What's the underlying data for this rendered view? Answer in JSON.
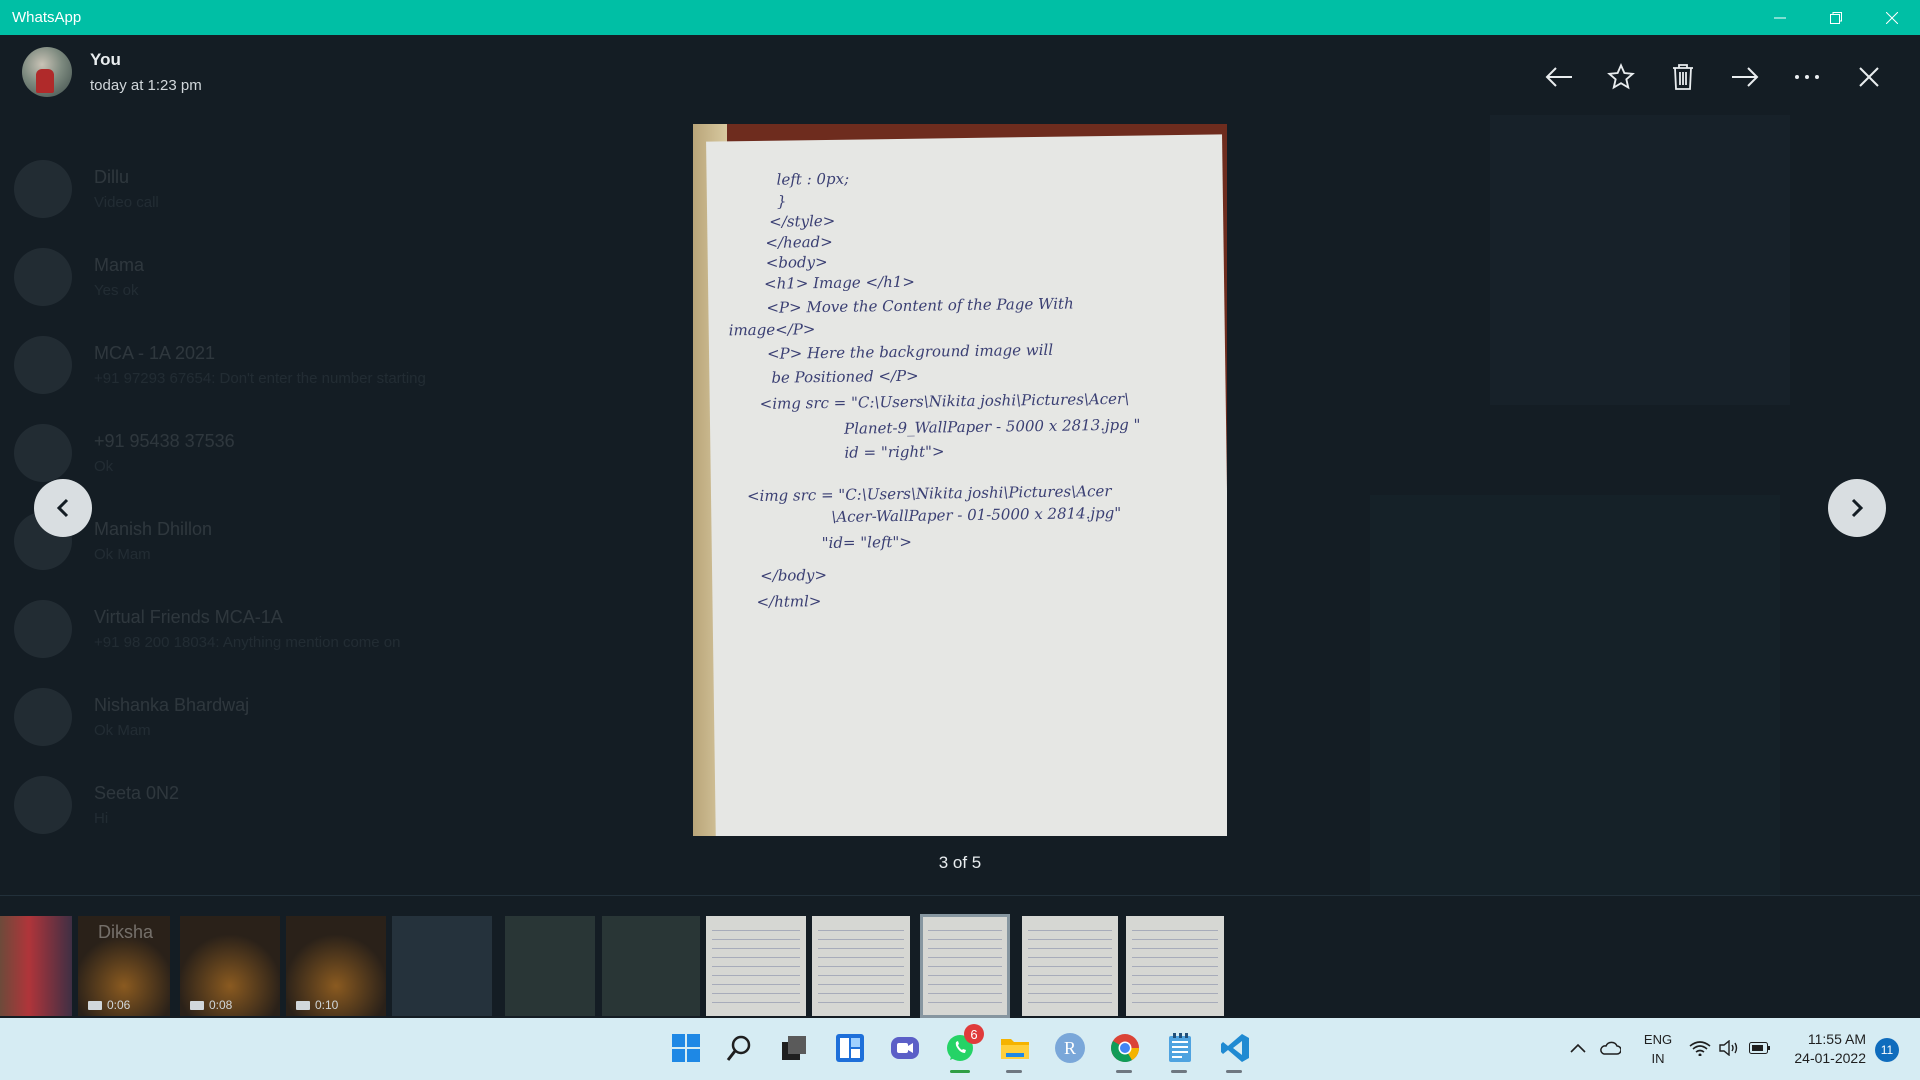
{
  "window": {
    "title": "WhatsApp",
    "controls": [
      "minimize-icon",
      "restore-icon",
      "close-icon"
    ]
  },
  "header": {
    "sender_name": "You",
    "timestamp": "today at 1:23 pm"
  },
  "toolbar": {
    "items": [
      {
        "name": "back-button",
        "icon": "arrow-left-icon"
      },
      {
        "name": "star-button",
        "icon": "star-icon"
      },
      {
        "name": "delete-button",
        "icon": "trash-icon"
      },
      {
        "name": "forward-button",
        "icon": "arrow-right-icon"
      },
      {
        "name": "more-options-button",
        "icon": "ellipsis-icon"
      },
      {
        "name": "close-viewer-button",
        "icon": "close-icon"
      }
    ]
  },
  "background_chats": [
    {
      "name": "Dillu",
      "preview": "Video call"
    },
    {
      "name": "Mama",
      "preview": "Yes ok"
    },
    {
      "name": "MCA - 1A 2021",
      "preview": "+91 97293 67654: Don't enter the number starting"
    },
    {
      "name": "+91 95438 37536",
      "preview": "Ok"
    },
    {
      "name": "Manish Dhillon",
      "preview": "Ok Mam"
    },
    {
      "name": "Virtual Friends MCA-1A",
      "preview": "+91 98 200 18034: Anything mention come on"
    },
    {
      "name": "Nishanka Bhardwaj",
      "preview": "Ok Mam"
    },
    {
      "name": "Seeta 0N2",
      "preview": "Hi"
    }
  ],
  "media": {
    "handwritten_lines": [
      "left : 0px;",
      "}",
      "</style>",
      "</head>",
      "<body>",
      "<h1> Image </h1>",
      "<P> Move the Content of the Page With",
      "image</P>",
      "<P> Here the background image will",
      "be Positioned </P>",
      "<img src = \"C:\\Users\\Nikita joshi\\Pictures\\Acer\\",
      "Planet-9_WallPaper - 5000 x 2813.jpg \"",
      "id = \"right\">",
      "<img src = \"C:\\Users\\Nikita joshi\\Pictures\\Acer",
      "\\Acer-WallPaper - 01-5000 x 2814.jpg\"",
      "\"id= \"left\">",
      "</body>",
      "</html>"
    ]
  },
  "counter": "3 of 5",
  "nav": {
    "prev_icon": "chevron-left-icon",
    "next_icon": "chevron-right-icon"
  },
  "thumbnails": [
    {
      "kind": "photo",
      "duration": ""
    },
    {
      "kind": "video",
      "duration": "0:06",
      "overlay": "Diksha"
    },
    {
      "kind": "video",
      "duration": "0:08"
    },
    {
      "kind": "video",
      "duration": "0:10"
    },
    {
      "kind": "screen",
      "duration": ""
    },
    {
      "kind": "photo",
      "duration": ""
    },
    {
      "kind": "photo",
      "duration": ""
    },
    {
      "kind": "document",
      "duration": ""
    },
    {
      "kind": "document",
      "duration": ""
    },
    {
      "kind": "document",
      "duration": "",
      "selected": true
    },
    {
      "kind": "document",
      "duration": ""
    },
    {
      "kind": "document",
      "duration": ""
    }
  ],
  "taskbar": {
    "apps": [
      {
        "name": "start-button",
        "icon": "windows-icon"
      },
      {
        "name": "search-button",
        "icon": "search-icon"
      },
      {
        "name": "task-view-button",
        "icon": "task-view-icon"
      },
      {
        "name": "widgets-button",
        "icon": "widgets-icon"
      },
      {
        "name": "teams-chat-button",
        "icon": "video-chat-icon"
      },
      {
        "name": "whatsapp-taskbar-button",
        "icon": "whatsapp-icon",
        "badge": "6"
      },
      {
        "name": "file-explorer-button",
        "icon": "folder-icon"
      },
      {
        "name": "r-app-button",
        "icon": "r-letter-icon",
        "label": "R"
      },
      {
        "name": "chrome-button",
        "icon": "chrome-icon"
      },
      {
        "name": "notepad-button",
        "icon": "notepad-icon"
      },
      {
        "name": "vscode-button",
        "icon": "vscode-icon"
      }
    ],
    "tray": {
      "language_line1": "ENG",
      "language_line2": "IN",
      "time": "11:55 AM",
      "date": "24-01-2022",
      "notification_count": "11"
    }
  }
}
